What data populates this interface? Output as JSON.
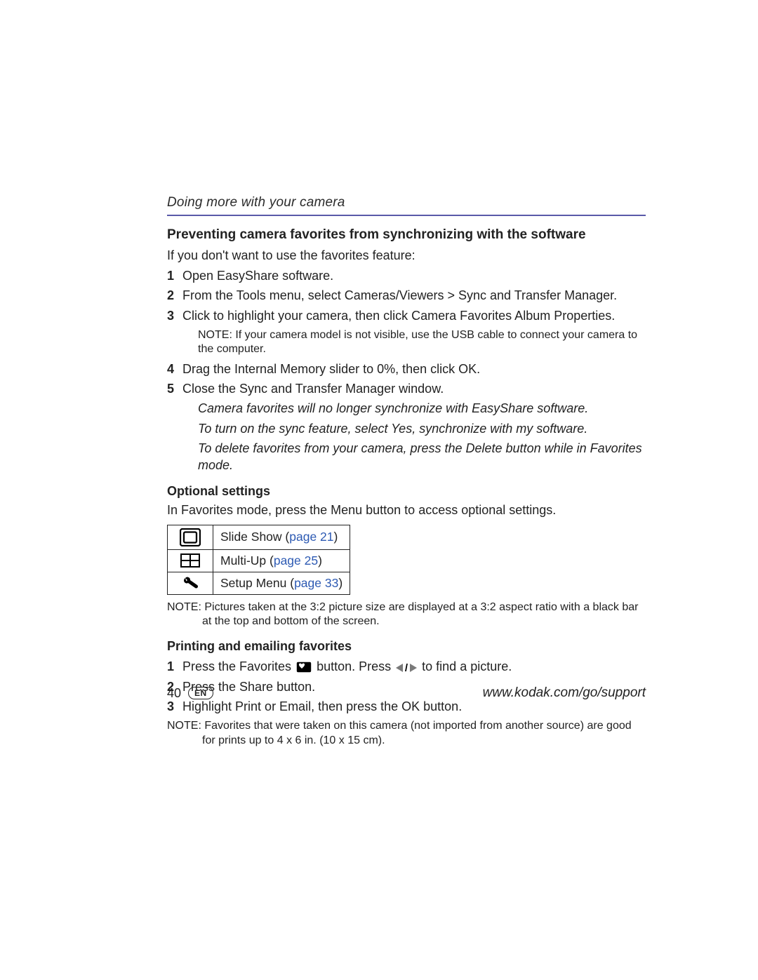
{
  "runningHead": "Doing more with your camera",
  "section1": {
    "title": "Preventing camera favorites from synchronizing with the software",
    "intro": "If you don't want to use the favorites feature:",
    "steps": [
      "Open EasyShare software.",
      "From the Tools menu, select Cameras/Viewers > Sync and Transfer Manager.",
      "Click to highlight your camera, then click Camera Favorites Album Properties.",
      "Drag the Internal Memory slider to 0%, then click OK.",
      "Close the Sync and Transfer Manager window."
    ],
    "noteAfter3": {
      "label": "NOTE:",
      "text": "If your camera model is not visible, use the USB cable to connect your camera to the computer."
    },
    "resultLines": [
      "Camera favorites will no longer synchronize with EasyShare software.",
      "To turn on the sync feature, select Yes, synchronize with my software.",
      "To delete favorites from your camera, press the Delete button while in Favorites mode."
    ]
  },
  "optional": {
    "heading": "Optional settings",
    "intro": "In Favorites mode, press the Menu button to access optional settings.",
    "rows": [
      {
        "label": "Slide Show (",
        "link": "page 21",
        "close": ")"
      },
      {
        "label": "Multi-Up (",
        "link": "page 25",
        "close": ")"
      },
      {
        "label": "Setup Menu (",
        "link": "page 33",
        "close": ")"
      }
    ],
    "note": {
      "label": "NOTE:",
      "text": "Pictures taken at the 3:2 picture size are displayed at a 3:2 aspect ratio with a black bar at the top and bottom of the screen."
    }
  },
  "printing": {
    "heading": "Printing and emailing favorites",
    "step1_a": "Press the Favorites ",
    "step1_b": " button. Press ",
    "step1_c": " to find a picture.",
    "step2": "Press the Share button.",
    "step3": "Highlight Print or Email, then press the OK button.",
    "note": {
      "label": "NOTE:",
      "text": "Favorites that were taken on this camera (not imported from another source) are good for prints up to 4 x 6 in. (10 x 15 cm)."
    }
  },
  "footer": {
    "pageNum": "40",
    "lang": "EN",
    "url": "www.kodak.com/go/support"
  }
}
